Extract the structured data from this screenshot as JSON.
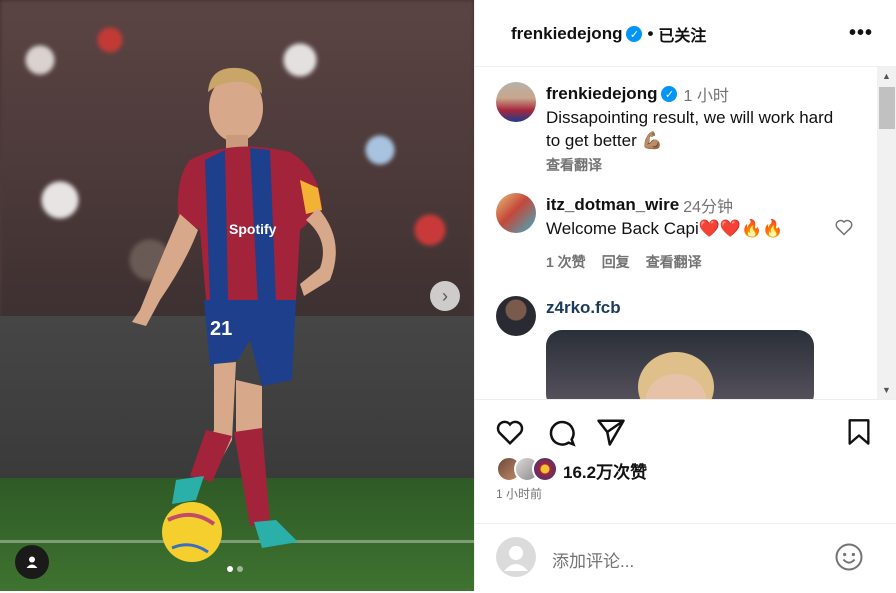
{
  "post": {
    "author": "frenkiedejong",
    "follow_status": "已关注",
    "caption_time": "1 小时",
    "caption": "Dissapointing result, we will work hard to get better 💪🏽",
    "translate": "查看翻译",
    "likes": "16.2万次赞",
    "posted": "1 小时前",
    "image_alt": "Frenkie de Jong dribbling in Barcelona kit number 21"
  },
  "comments": [
    {
      "user": "itz_dotman_wire",
      "time": "24分钟",
      "text": "Welcome Back Capi❤️❤️🔥🔥",
      "likes": "1 次赞",
      "reply": "回复",
      "translate": "查看翻译"
    },
    {
      "user": "z4rko.fcb"
    }
  ],
  "add_comment": {
    "placeholder": "添加评论..."
  },
  "kit": {
    "sponsor": "Spotify",
    "number": "21"
  },
  "colors": {
    "verified": "#0095f6",
    "text": "#111111",
    "muted": "#737373"
  }
}
